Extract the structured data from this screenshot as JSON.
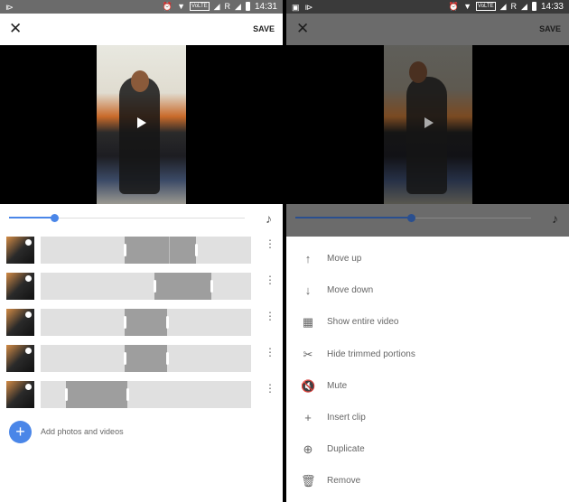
{
  "left_screen": {
    "status_bar": {
      "time": "14:31",
      "icons": [
        "cast-icon",
        "alarm-icon",
        "wifi-icon",
        "volte-icon",
        "signal-icon",
        "roaming-signal-icon",
        "battery-icon"
      ],
      "volte_label": "VoLTE",
      "roaming_label": "R"
    },
    "app_bar": {
      "close_label": "✕",
      "save_label": "SAVE"
    },
    "playback_progress": 0.19,
    "clips": [
      {
        "trim_start": 0.4,
        "trim_end": 0.74,
        "split_at": 0.61
      },
      {
        "trim_start": 0.54,
        "trim_end": 0.81
      },
      {
        "trim_start": 0.4,
        "trim_end": 0.6
      },
      {
        "trim_start": 0.4,
        "trim_end": 0.6
      },
      {
        "trim_start": 0.12,
        "trim_end": 0.41
      }
    ],
    "add_label": "Add photos and videos",
    "add_icon": "+"
  },
  "right_screen": {
    "status_bar": {
      "time": "14:33",
      "icons": [
        "image-icon",
        "cast-icon",
        "alarm-icon",
        "wifi-icon",
        "volte-icon",
        "signal-icon",
        "roaming-signal-icon",
        "battery-icon"
      ],
      "volte_label": "VoLTE",
      "roaming_label": "R"
    },
    "app_bar": {
      "close_label": "✕",
      "save_label": "SAVE"
    },
    "playback_progress": 0.49,
    "menu": [
      {
        "icon": "arrow-up-icon",
        "glyph": "↑",
        "label": "Move up"
      },
      {
        "icon": "arrow-down-icon",
        "glyph": "↓",
        "label": "Move down"
      },
      {
        "icon": "film-icon",
        "glyph": "▦",
        "label": "Show entire video"
      },
      {
        "icon": "scissors-icon",
        "glyph": "✂",
        "label": "Hide trimmed portions"
      },
      {
        "icon": "mute-icon",
        "glyph": "🔇",
        "label": "Mute"
      },
      {
        "icon": "plus-icon",
        "glyph": "+",
        "label": "Insert clip"
      },
      {
        "icon": "duplicate-icon",
        "glyph": "⊕",
        "label": "Duplicate"
      },
      {
        "icon": "trash-icon",
        "glyph": "🗑",
        "label": "Remove"
      }
    ]
  },
  "colors": {
    "accent": "#4a86e8",
    "track": "#e0e0e0",
    "selection": "#9e9e9e",
    "text_secondary": "#666666"
  }
}
